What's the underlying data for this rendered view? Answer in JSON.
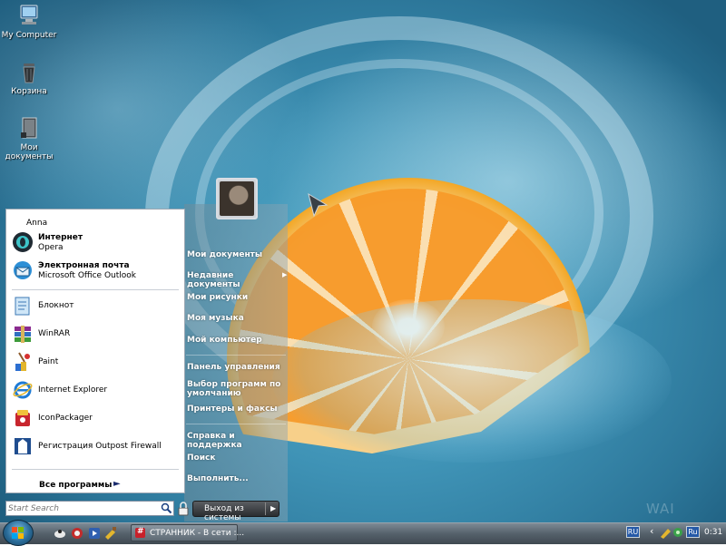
{
  "desktop": {
    "icons": [
      {
        "label": "My Computer",
        "icon": "my-computer-icon"
      },
      {
        "label": "Корзина",
        "icon": "recycle-bin-icon"
      },
      {
        "label": "Мои документы",
        "icon": "my-documents-icon"
      }
    ],
    "watermark": "WAI"
  },
  "start_menu": {
    "user_name": "Anna",
    "pinned": [
      {
        "title": "Интернет",
        "subtitle": "Opera",
        "icon": "opera-icon"
      },
      {
        "title": "Электронная почта",
        "subtitle": "Microsoft Office Outlook",
        "icon": "outlook-icon"
      }
    ],
    "recent": [
      {
        "label": "Блокнот",
        "icon": "notepad-icon"
      },
      {
        "label": "WinRAR",
        "icon": "winrar-icon"
      },
      {
        "label": "Paint",
        "icon": "paint-icon"
      },
      {
        "label": "Internet Explorer",
        "icon": "internet-explorer-icon"
      },
      {
        "label": "IconPackager",
        "icon": "iconpackager-icon"
      },
      {
        "label": "Регистрация Outpost Firewall",
        "icon": "outpost-firewall-icon"
      }
    ],
    "all_programs": "Все программы",
    "search_placeholder": "Start Search",
    "right_items": {
      "group1": [
        "Мои документы",
        "Недавние документы",
        "Мои рисунки",
        "Моя музыка",
        "Мой компьютер"
      ],
      "group2": [
        "Панель управления",
        "Выбор программ по умолчанию",
        "Принтеры и факсы"
      ],
      "group3": [
        "Справка и поддержка",
        "Поиск",
        "Выполнить..."
      ]
    },
    "logoff_label": "Выход из системы"
  },
  "taskbar": {
    "task_button": "СТРАННИК - В сети :...",
    "lang_left": "RU",
    "lang_tray": "Ru",
    "clock": "0:31"
  },
  "colors": {
    "accent": "#2559a7",
    "menu_left_bg": "#ffffff",
    "taskbar": "#55616b"
  }
}
